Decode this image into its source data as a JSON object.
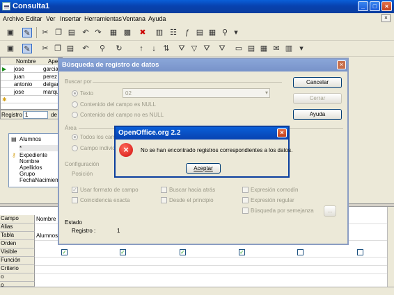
{
  "window": {
    "title": "Consulta1"
  },
  "menu": [
    "Archivo",
    "Editar",
    "Ver",
    "Insertar",
    "Herramientas",
    "Ventana",
    "Ayuda"
  ],
  "datagrid": {
    "columns": [
      "Nombre",
      "Ape"
    ],
    "rows": [
      [
        "jose",
        "garcia"
      ],
      [
        "juan",
        "perez"
      ],
      [
        "antonio",
        "delgad"
      ],
      [
        "jose",
        "marqu"
      ]
    ],
    "nav_label": "Registro",
    "nav_value": "1",
    "nav_of": "de"
  },
  "table_box": {
    "title": "Alumnos",
    "fields": [
      "*",
      "Expediente",
      "Nombre",
      "Apellidos",
      "Grupo",
      "FechaNacimient"
    ]
  },
  "query_grid": {
    "row_labels": [
      "Campo",
      "Alias",
      "Tabla",
      "Orden",
      "Visible",
      "Función",
      "Criterio",
      "o",
      "o"
    ],
    "field": "Nombre",
    "table": "Alumnos",
    "visible": [
      true,
      true,
      true,
      true,
      false,
      false
    ]
  },
  "search_dialog": {
    "title": "Búsqueda de registro de datos",
    "section_search": "Buscar por",
    "opt_text": "Texto",
    "text_value": "02",
    "opt_null": "Contenido del campo es NULL",
    "opt_notnull": "Contenido del campo no es NULL",
    "section_area": "Área",
    "opt_all": "Todos los campos",
    "opt_single": "Campo individual",
    "section_config": "Configuración",
    "position_label": "Posición",
    "chk_format": "Usar formato de campo",
    "chk_exact": "Coincidencia exacta",
    "chk_back": "Buscar hacia atrás",
    "chk_start": "Desde el principio",
    "chk_wild": "Expresión comodín",
    "chk_regex": "Expresión regular",
    "chk_sim": "Búsqueda por semejanza",
    "sim_btn": "...",
    "section_state": "Estado",
    "record_label": "Registro :",
    "record_value": "1",
    "btn_cancel": "Cancelar",
    "btn_close": "Cerrar",
    "btn_help": "Ayuda"
  },
  "alert": {
    "title": "OpenOffice.org 2.2",
    "message": "No se han encontrado registros correspondientes a los datos.",
    "ok": "Aceptar"
  }
}
